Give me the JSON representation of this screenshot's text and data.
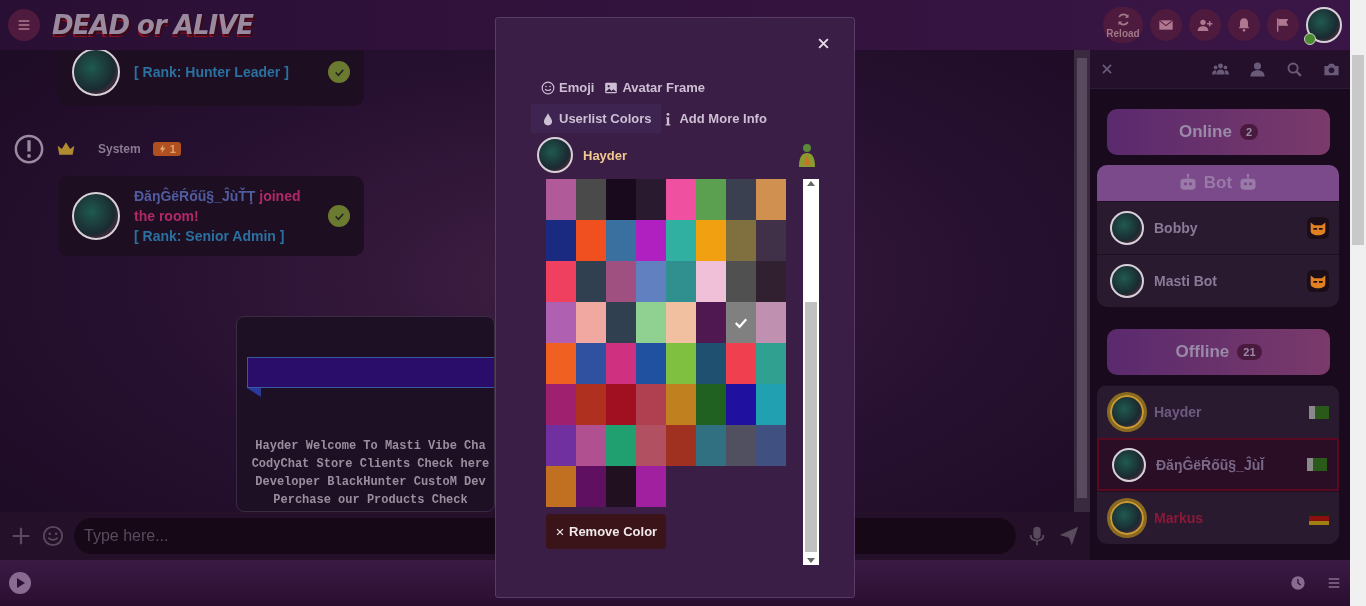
{
  "topbar": {
    "logo": "DEAD or ALIVE",
    "reload_label": "Reload"
  },
  "chat": {
    "messages": [
      {
        "kind": "rank",
        "rank": "[ Rank: Hunter Leader ]"
      },
      {
        "kind": "system",
        "sender": "System",
        "badge": "1"
      },
      {
        "kind": "rank",
        "author": "ĐăŋĜëŔőű§_ĴùŤŢ",
        "text": "joined the room!",
        "rank": "[ Rank: Senior Admin ]"
      }
    ],
    "announcement": {
      "lines": [
        "Hayder Welcome To Masti Vibe Cha",
        "CodyChat Store Clients Check here",
        "Developer BlackHunter CustoM Dev",
        "Perchase our Products Check"
      ]
    },
    "input": {
      "placeholder": "Type here..."
    }
  },
  "panel": {
    "online": {
      "label": "Online",
      "count": "2"
    },
    "bot_header": "Bot",
    "bots": [
      {
        "name": "Bobby"
      },
      {
        "name": "Masti Bot"
      }
    ],
    "offline": {
      "label": "Offline",
      "count": "21"
    },
    "offline_users": [
      {
        "name": "Hayder",
        "color": "#6e5a80",
        "framed": true,
        "selected": false
      },
      {
        "name": "ĐăŋĜëŔőũ§_ĴùĬ",
        "color": "#7a6888",
        "framed": false,
        "selected": true
      },
      {
        "name": "Markus",
        "color": "#8c1838",
        "framed": true,
        "selected": false
      }
    ]
  },
  "modal": {
    "tabs": [
      {
        "label": "Emoji",
        "selected": false
      },
      {
        "label": "Avatar Frame",
        "selected": false
      },
      {
        "label": "Userlist Colors",
        "selected": true
      },
      {
        "label": "Add More Info",
        "selected": false
      }
    ],
    "preview_name": "Hayder",
    "swatches": [
      {
        "color": "#b05a9a",
        "selected": false
      },
      {
        "color": "#4a4a4a",
        "selected": false
      },
      {
        "color": "#1a0a1e",
        "selected": false
      },
      {
        "color": "#2a1a30",
        "selected": false
      },
      {
        "color": "#f050a0",
        "selected": false
      },
      {
        "color": "#5aa050",
        "selected": false
      },
      {
        "color": "#3a4050",
        "selected": false
      },
      {
        "color": "#d09050",
        "selected": false
      },
      {
        "color": "#1a2a80",
        "selected": false
      },
      {
        "color": "#f05020",
        "selected": false
      },
      {
        "color": "#3a70a0",
        "selected": false
      },
      {
        "color": "#b020c0",
        "selected": false
      },
      {
        "color": "#30b0a0",
        "selected": false
      },
      {
        "color": "#f0a010",
        "selected": false
      },
      {
        "color": "#807040",
        "selected": false
      },
      {
        "color": "#403048",
        "selected": false
      },
      {
        "color": "#f04060",
        "selected": false
      },
      {
        "color": "#304050",
        "selected": false
      },
      {
        "color": "#a05080",
        "selected": false
      },
      {
        "color": "#6080c0",
        "selected": false
      },
      {
        "color": "#309090",
        "selected": false
      },
      {
        "color": "#f0c0d8",
        "selected": false
      },
      {
        "color": "#505050",
        "selected": false
      },
      {
        "color": "#302030",
        "selected": false
      },
      {
        "color": "#b060b0",
        "selected": false
      },
      {
        "color": "#f0a8a0",
        "selected": false
      },
      {
        "color": "#304050",
        "selected": false
      },
      {
        "color": "#90d090",
        "selected": false
      },
      {
        "color": "#f0c0a0",
        "selected": false
      },
      {
        "color": "#501850",
        "selected": false
      },
      {
        "color": "#808080",
        "selected": true
      },
      {
        "color": "#c090b0",
        "selected": false
      },
      {
        "color": "#f06020",
        "selected": false
      },
      {
        "color": "#3050a0",
        "selected": false
      },
      {
        "color": "#d03080",
        "selected": false
      },
      {
        "color": "#2050a0",
        "selected": false
      },
      {
        "color": "#80c040",
        "selected": false
      },
      {
        "color": "#205070",
        "selected": false
      },
      {
        "color": "#f04050",
        "selected": false
      },
      {
        "color": "#30a090",
        "selected": false
      },
      {
        "color": "#a02070",
        "selected": false
      },
      {
        "color": "#b03020",
        "selected": false
      },
      {
        "color": "#a01020",
        "selected": false
      },
      {
        "color": "#b04050",
        "selected": false
      },
      {
        "color": "#c08020",
        "selected": false
      },
      {
        "color": "#206020",
        "selected": false
      },
      {
        "color": "#2010a0",
        "selected": false
      },
      {
        "color": "#20a0b0",
        "selected": false
      },
      {
        "color": "#7030a0",
        "selected": false
      },
      {
        "color": "#b05090",
        "selected": false
      },
      {
        "color": "#20a070",
        "selected": false
      },
      {
        "color": "#b05060",
        "selected": false
      },
      {
        "color": "#a03020",
        "selected": false
      },
      {
        "color": "#307080",
        "selected": false
      },
      {
        "color": "#505060",
        "selected": false
      },
      {
        "color": "#405080",
        "selected": false
      },
      {
        "color": "#c07020",
        "selected": false
      },
      {
        "color": "#601060",
        "selected": false
      },
      {
        "color": "#201020",
        "selected": false
      },
      {
        "color": "#a020a0",
        "selected": false
      }
    ],
    "remove_label": "Remove Color"
  }
}
